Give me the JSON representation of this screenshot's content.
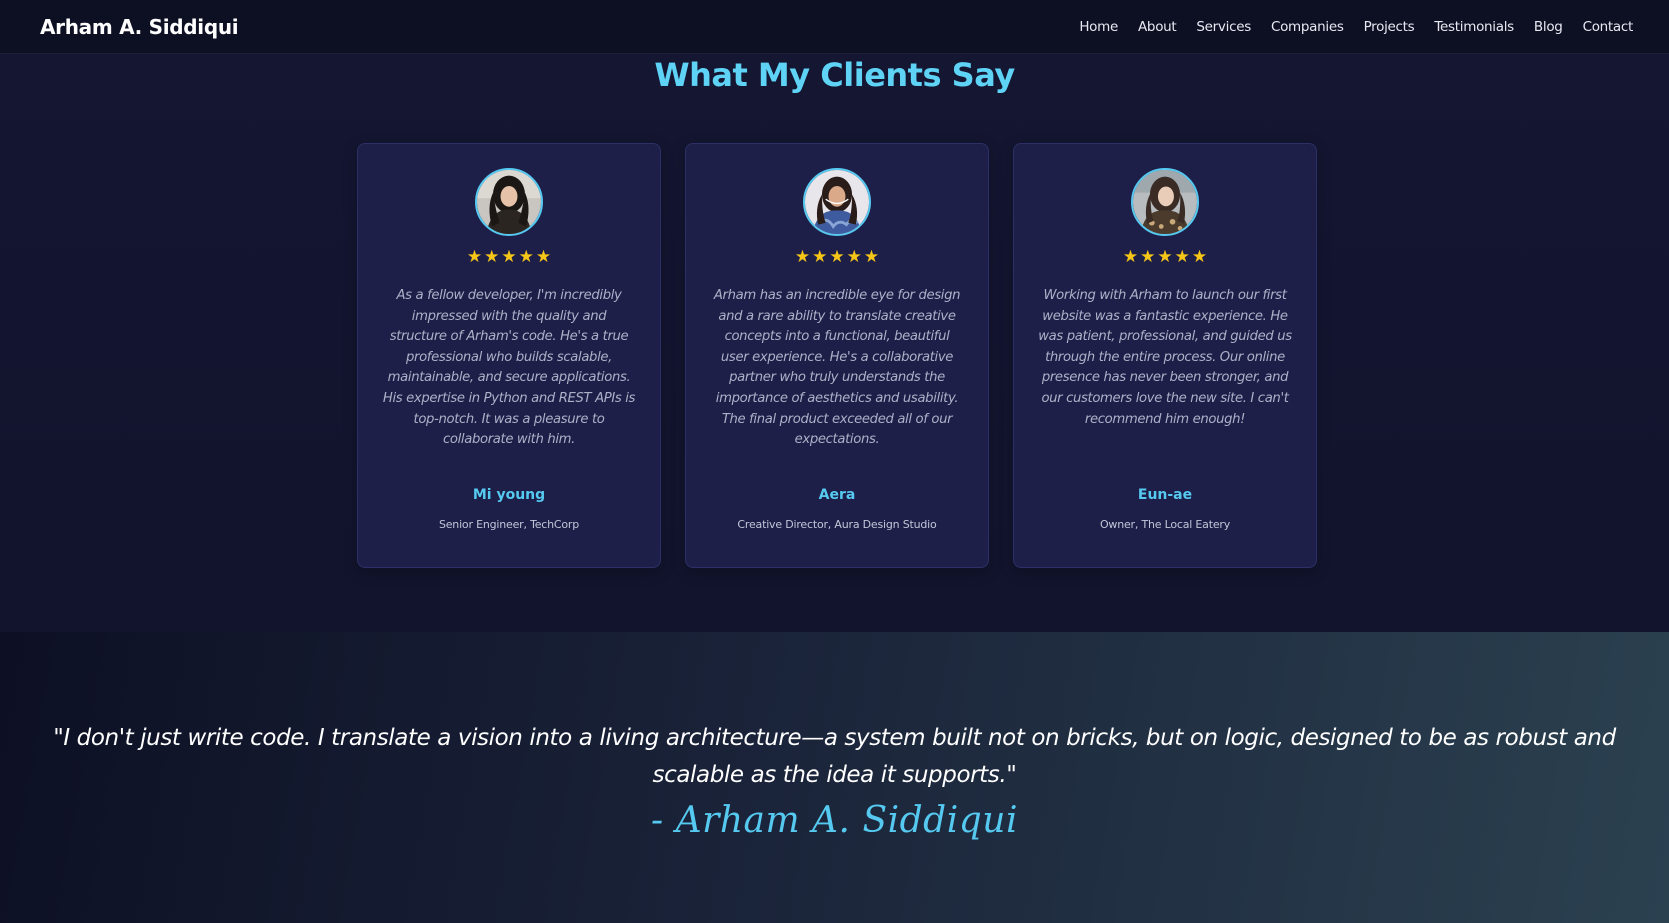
{
  "brand": "Arham A. Siddiqui",
  "nav": {
    "items": [
      "Home",
      "About",
      "Services",
      "Companies",
      "Projects",
      "Testimonials",
      "Blog",
      "Contact"
    ]
  },
  "testimonials": {
    "title": "What My Clients Say",
    "rating_glyph": "★",
    "cards": [
      {
        "quote": "As a fellow developer, I'm incredibly impressed with the quality and structure of Arham's code. He's a true professional who builds scalable, maintainable, and secure applications. His expertise in Python and REST APIs is top-notch. It was a pleasure to collaborate with him.",
        "name": "Mi young",
        "role": "Senior Engineer, TechCorp",
        "rating": 5
      },
      {
        "quote": "Arham has an incredible eye for design and a rare ability to translate creative concepts into a functional, beautiful user experience. He's a collaborative partner who truly understands the importance of aesthetics and usability. The final product exceeded all of our expectations.",
        "name": "Aera",
        "role": "Creative Director, Aura Design Studio",
        "rating": 5
      },
      {
        "quote": "Working with Arham to launch our first website was a fantastic experience. He was patient, professional, and guided us through the entire process. Our online presence has never been stronger, and our customers love the new site. I can't recommend him enough!",
        "name": "Eun-ae",
        "role": "Owner, The Local Eatery",
        "rating": 5
      }
    ]
  },
  "banner": {
    "quote": "\"I don't just write code. I translate a vision into a living architecture—a system built not on bricks, but on logic, designed to be as robust and scalable as the idea it supports.\"",
    "signature": "- Arham A. Siddiqui"
  },
  "colors": {
    "accent": "#5fd3f6",
    "star": "#f5c518",
    "card_bg": "#1d1f48",
    "page_bg": "#12142c"
  },
  "icons": {
    "star": "star-icon",
    "avatar": "avatar-photo"
  }
}
